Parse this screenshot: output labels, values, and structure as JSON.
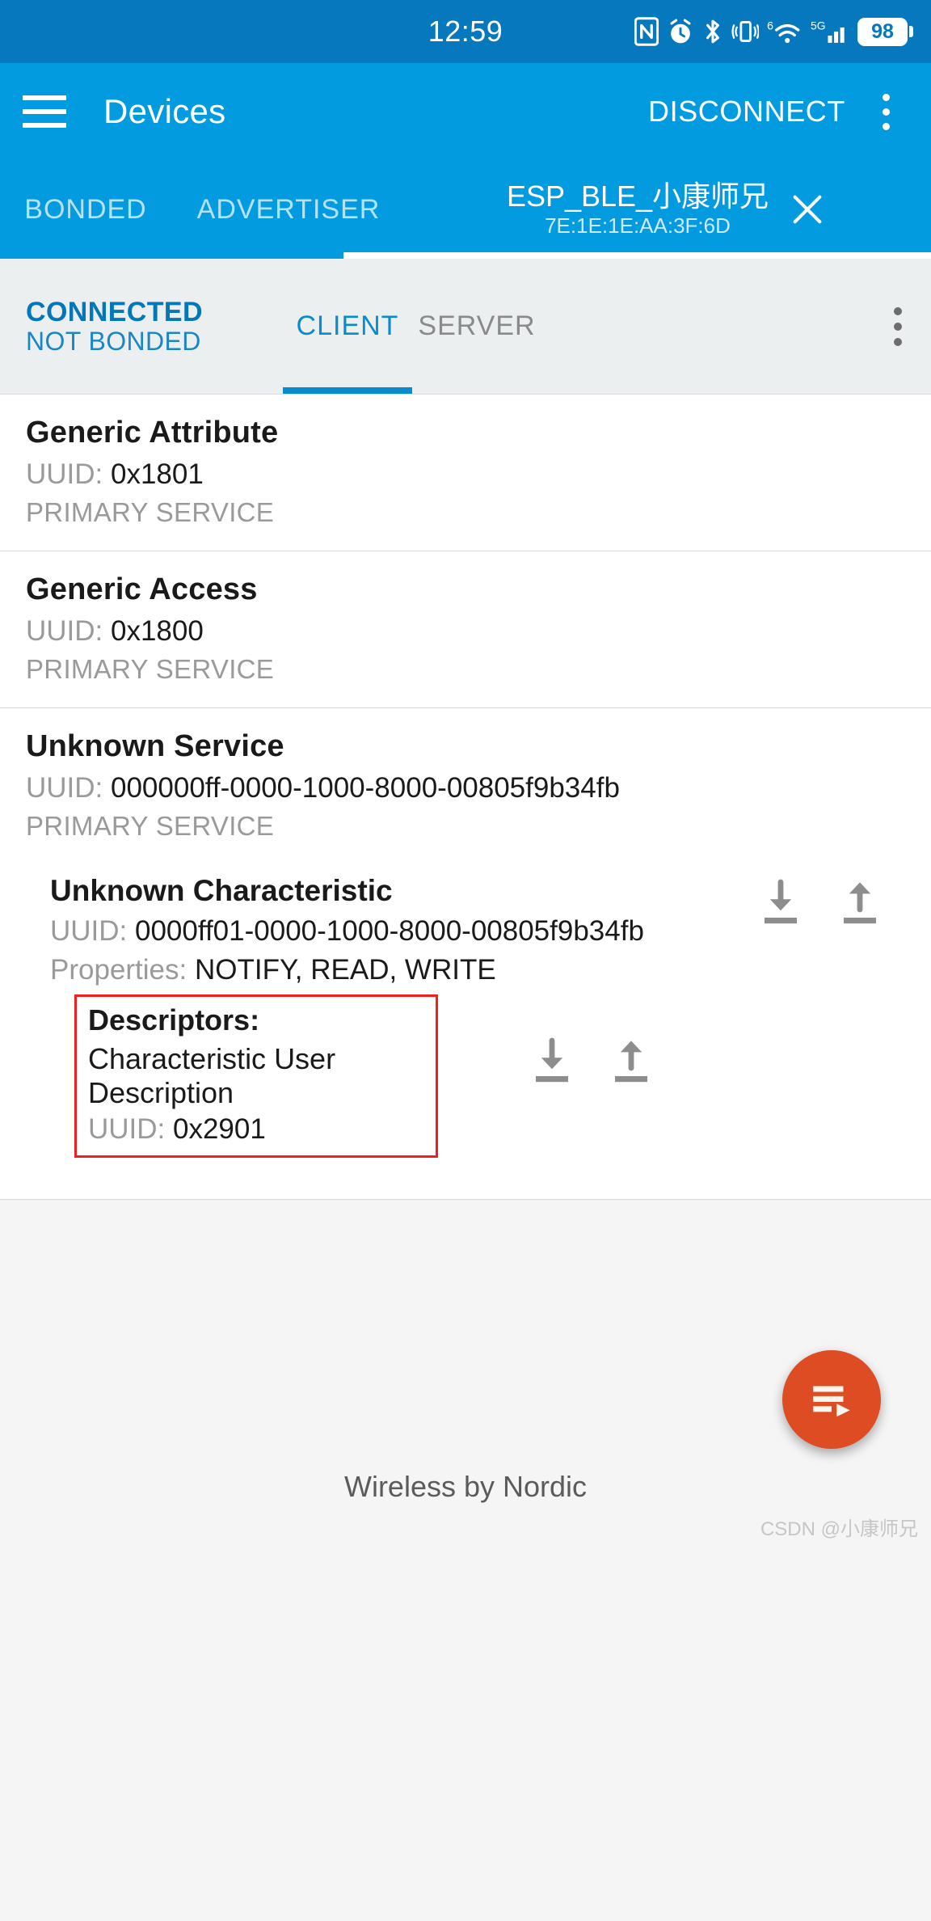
{
  "statusbar": {
    "clock": "12:59",
    "battery_level": "98",
    "icons": [
      "nfc-icon",
      "alarm-icon",
      "bluetooth-icon",
      "vibrate-icon",
      "wifi6-icon",
      "signal-5g-icon",
      "battery-icon"
    ]
  },
  "appbar": {
    "menu_icon": "hamburger-icon",
    "title": "Devices",
    "action": "DISCONNECT",
    "overflow_icon": "more-vertical-icon"
  },
  "device_tabs": {
    "bonded": "BONDED",
    "advertiser": "ADVERTISER",
    "active_name": "ESP_BLE_小康师兄",
    "active_mac": "7E:1E:1E:AA:3F:6D",
    "close_icon": "close-icon"
  },
  "connection": {
    "state": "CONNECTED",
    "bond": "NOT BONDED",
    "tabs": [
      {
        "label": "CLIENT",
        "active": true
      },
      {
        "label": "SERVER",
        "active": false
      }
    ],
    "overflow_icon": "more-vertical-icon"
  },
  "services": [
    {
      "name": "Generic Attribute",
      "uuid_label": "UUID: ",
      "uuid": "0x1801",
      "type": "PRIMARY SERVICE"
    },
    {
      "name": "Generic Access",
      "uuid_label": "UUID: ",
      "uuid": "0x1800",
      "type": "PRIMARY SERVICE"
    },
    {
      "name": "Unknown Service",
      "uuid_label": "UUID: ",
      "uuid": "000000ff-0000-1000-8000-00805f9b34fb",
      "type": "PRIMARY SERVICE"
    }
  ],
  "characteristic": {
    "name": "Unknown Characteristic",
    "uuid_label": "UUID: ",
    "uuid": "0000ff01-0000-1000-8000-00805f9b34fb",
    "properties_label": "Properties: ",
    "properties": "NOTIFY, READ, WRITE",
    "read_icon": "download-arrow-icon",
    "write_icon": "upload-arrow-icon"
  },
  "descriptor": {
    "title": "Descriptors:",
    "name": "Characteristic User Description",
    "uuid_label": "UUID: ",
    "uuid": "0x2901",
    "read_icon": "download-arrow-icon",
    "write_icon": "upload-arrow-icon",
    "highlight_color": "#ef2020"
  },
  "footer": {
    "text": "Wireless by Nordic",
    "fab_icon": "playlist-play-icon",
    "fab_color": "#dd4c23",
    "watermark": "CSDN @小康师兄"
  },
  "theme": {
    "statusbar_bg": "#0679be",
    "appbar_bg": "#039be0",
    "accent": "#0a8ccc",
    "page_bg": "#f5f5f5"
  }
}
